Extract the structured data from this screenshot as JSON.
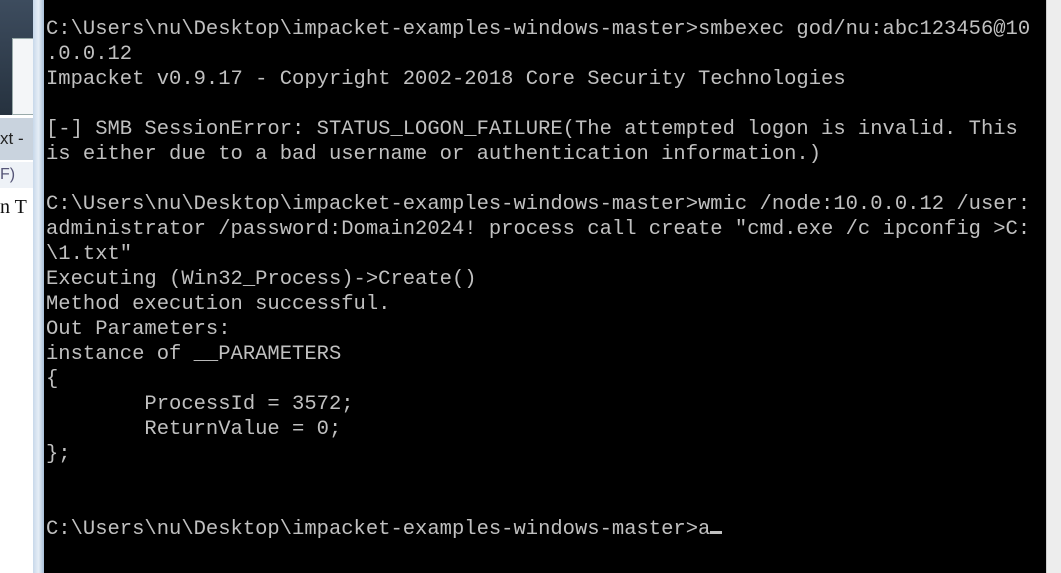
{
  "background_window": {
    "title_fragment": "xt -",
    "menu_fragment": "F)",
    "text_fragment": "n T"
  },
  "terminal": {
    "lines": [
      "C:\\Users\\nu\\Desktop\\impacket-examples-windows-master>smbexec god/nu:abc123456@10",
      ".0.0.12",
      "Impacket v0.9.17 - Copyright 2002-2018 Core Security Technologies",
      "",
      "[-] SMB SessionError: STATUS_LOGON_FAILURE(The attempted logon is invalid. This",
      "is either due to a bad username or authentication information.)",
      "",
      "C:\\Users\\nu\\Desktop\\impacket-examples-windows-master>wmic /node:10.0.0.12 /user:",
      "administrator /password:Domain2024! process call create \"cmd.exe /c ipconfig >C:",
      "\\1.txt\"",
      "Executing (Win32_Process)->Create()",
      "Method execution successful.",
      "Out Parameters:",
      "instance of __PARAMETERS",
      "{",
      "        ProcessId = 3572;",
      "        ReturnValue = 0;",
      "};",
      "",
      ""
    ],
    "prompt": "C:\\Users\\nu\\Desktop\\impacket-examples-windows-master>",
    "current_input": "a"
  },
  "colors": {
    "terminal_bg": "#000000",
    "terminal_fg": "#c0c0c0"
  }
}
